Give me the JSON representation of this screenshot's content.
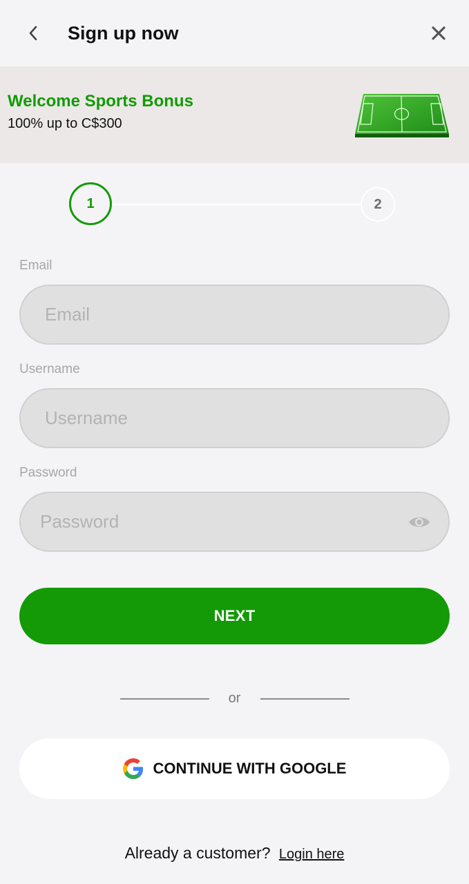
{
  "header": {
    "title": "Sign up now",
    "back_icon": "chevron-left-icon",
    "close_icon": "close-icon"
  },
  "banner": {
    "title": "Welcome Sports Bonus",
    "subtitle": "100% up to C$300",
    "image": "football-pitch-icon"
  },
  "stepper": {
    "step1": "1",
    "step2": "2",
    "current_step": 1
  },
  "form": {
    "email": {
      "label": "Email",
      "placeholder": "Email",
      "value": ""
    },
    "username": {
      "label": "Username",
      "placeholder": "Username",
      "value": ""
    },
    "password": {
      "label": "Password",
      "placeholder": "Password",
      "value": "",
      "toggle_icon": "eye-icon"
    }
  },
  "actions": {
    "next_label": "NEXT",
    "divider_text": "or",
    "google_label": "CONTINUE WITH GOOGLE",
    "google_icon": "google-icon"
  },
  "footer": {
    "prompt": "Already a customer?",
    "login_link": "Login here"
  },
  "colors": {
    "brand_green": "#139a06",
    "background": "#f4f4f6",
    "banner_bg": "#ebe8e7",
    "field_bg": "#e0e0e0"
  }
}
